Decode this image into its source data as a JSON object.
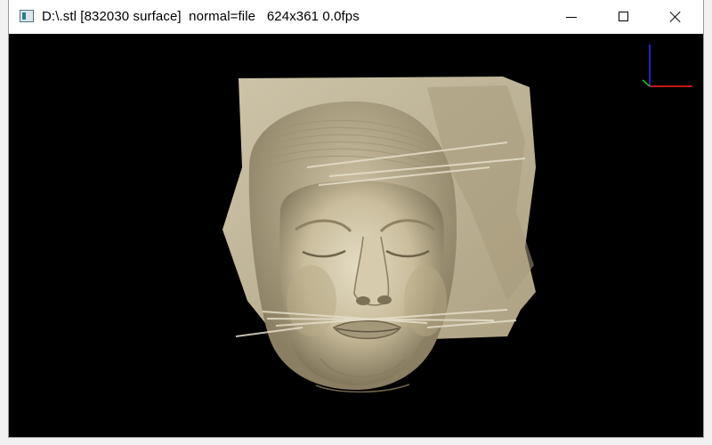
{
  "window": {
    "title": "D:\\.stl [832030 surface]  normal=file   624x361 0.0fps",
    "icon": "application-icon",
    "controls": [
      "minimize-icon",
      "maximize-icon",
      "close-icon"
    ]
  },
  "viewport": {
    "background": "#000000",
    "model_color": "#cfc3a2",
    "axes_colors": {
      "x": "#ff2020",
      "y": "#20c020",
      "z": "#3030ff"
    }
  }
}
